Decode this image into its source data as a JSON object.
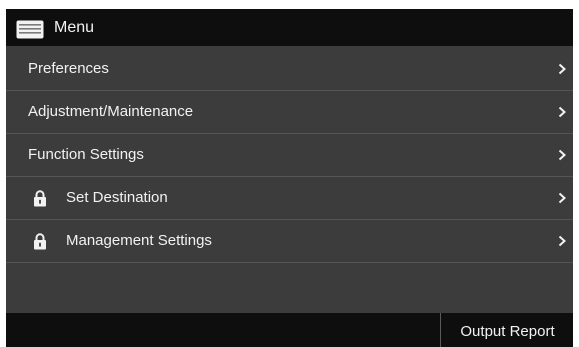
{
  "header": {
    "title": "Menu",
    "icon": "menu-screen-icon"
  },
  "menu": {
    "items": [
      {
        "label": "Preferences",
        "locked": false,
        "icon": "chevron-right-icon"
      },
      {
        "label": "Adjustment/Maintenance",
        "locked": false,
        "icon": "chevron-right-icon"
      },
      {
        "label": "Function Settings",
        "locked": false,
        "icon": "chevron-right-icon"
      },
      {
        "label": "Set Destination",
        "locked": true,
        "icon": "lock-icon"
      },
      {
        "label": "Management Settings",
        "locked": true,
        "icon": "lock-icon"
      }
    ]
  },
  "footer": {
    "output_report_label": "Output Report"
  },
  "colors": {
    "title_bar": "#0e0e0e",
    "list_background": "#3c3c3c",
    "divider": "#555555",
    "text": "#f2f2f2"
  }
}
